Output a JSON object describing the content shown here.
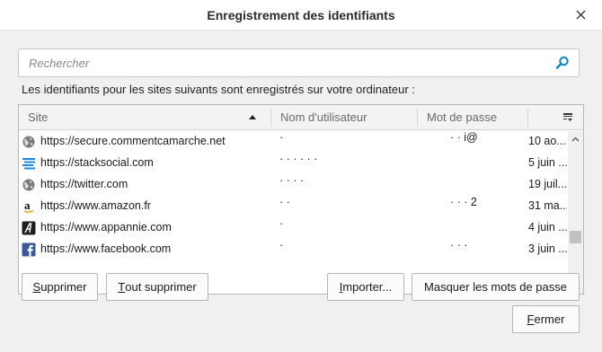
{
  "window": {
    "title": "Enregistrement des identifiants",
    "close_glyph": "✕"
  },
  "search": {
    "placeholder": "Rechercher",
    "icon": "search-icon"
  },
  "description": "Les identifiants pour les sites suivants sont enregistrés sur votre ordinateur :",
  "table": {
    "columns": {
      "site": "Site",
      "username": "Nom d'utilisateur",
      "password": "Mot de passe"
    },
    "sort": {
      "column": "site",
      "direction": "ascending"
    },
    "rows": [
      {
        "site": "https://secure.commentcamarche.net",
        "favicon": "globe-icon",
        "username": "·",
        "password": "·  ·  i@",
        "date": "10 ao..."
      },
      {
        "site": "https://stacksocial.com",
        "favicon": "stacksocial-icon",
        "username": "·  ·  ·  ·  ·  ·",
        "password": "",
        "date": "5 juin ..."
      },
      {
        "site": "https://twitter.com",
        "favicon": "globe-icon",
        "username": "·  ·  ·  ·",
        "password": "",
        "date": "19 juil..."
      },
      {
        "site": "https://www.amazon.fr",
        "favicon": "amazon-icon",
        "username": "  ·    ·",
        "password": "·  ·  ·  2",
        "date": "31 ma..."
      },
      {
        "site": "https://www.appannie.com",
        "favicon": "appannie-icon",
        "username": "·",
        "password": "",
        "date": "4 juin ..."
      },
      {
        "site": "https://www.facebook.com",
        "favicon": "facebook-icon",
        "username": "·",
        "password": "·  ·  ·",
        "date": "3 juin ..."
      }
    ]
  },
  "buttons": {
    "delete": {
      "mnemonic": "S",
      "rest": "upprimer"
    },
    "delete_all": {
      "mnemonic": "T",
      "rest": "out supprimer"
    },
    "import": {
      "mnemonic": "I",
      "rest": "mporter..."
    },
    "hide_passwords": {
      "label": "Masquer les mots de passe"
    },
    "close": {
      "mnemonic": "F",
      "rest": "ermer"
    }
  },
  "colors": {
    "dialog_bg": "#f0f0f0",
    "titlebar_bg": "#ffffff",
    "search_icon": "#0a84c6",
    "facebook": "#3b5998",
    "stacksocial": "#1e88e5"
  }
}
